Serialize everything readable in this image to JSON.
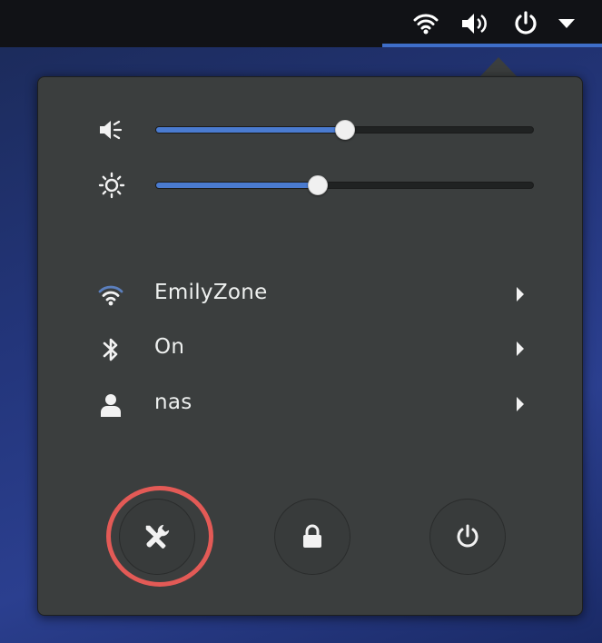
{
  "topbar": {
    "icons": [
      "wifi-icon",
      "volume-icon",
      "power-icon",
      "dropdown-arrow-icon"
    ]
  },
  "sliders": {
    "volume": {
      "icon": "volume-icon",
      "level": 0.5
    },
    "brightness": {
      "icon": "brightness-icon",
      "level": 0.43
    }
  },
  "items": [
    {
      "icon": "wifi-icon",
      "label": "EmilyZone"
    },
    {
      "icon": "bluetooth-icon",
      "label": "On"
    },
    {
      "icon": "user-icon",
      "label": "nas"
    }
  ],
  "actions": [
    {
      "icon": "settings-tools-icon",
      "highlighted": true
    },
    {
      "icon": "lock-icon"
    },
    {
      "icon": "power-icon"
    }
  ],
  "colors": {
    "accent": "#4a7bd0",
    "highlight": "#e35a56",
    "menu_bg": "#3b3e3e",
    "topbar_bg": "#111216"
  }
}
